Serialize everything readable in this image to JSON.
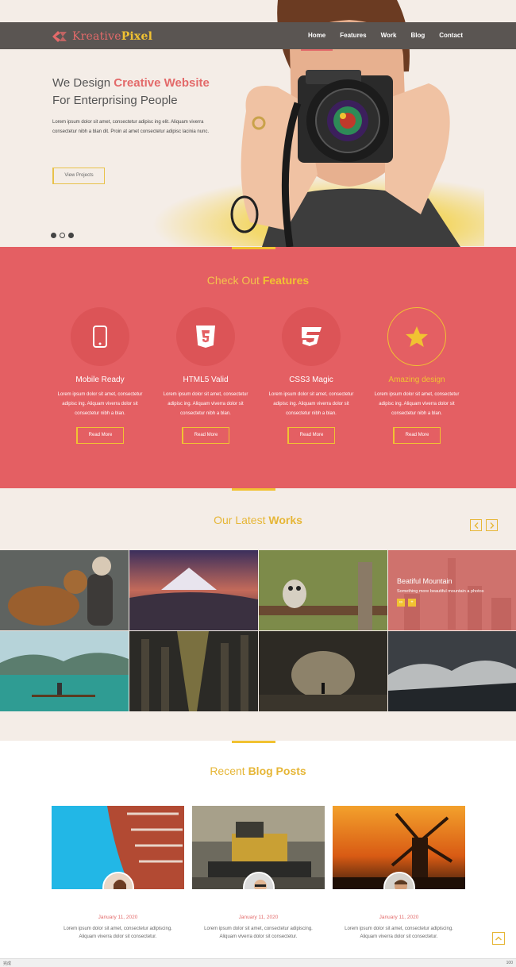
{
  "brand": {
    "name_part1": "Kreative",
    "name_part2": "Pixel"
  },
  "nav": {
    "items": [
      "Home",
      "Features",
      "Work",
      "Blog",
      "Contact"
    ],
    "active": "Home"
  },
  "hero": {
    "title_line1_prefix": "We Design ",
    "title_line1_highlight": "Creative Website",
    "title_line2": "For Enterprising People",
    "text": "Lorem ipsum dolor sit amet, consectetur adipisc ing elit. Aliquam viverra consectetur nibh a blan dit. Proin at amet consectetur adipisc lacinia nunc.",
    "button": "View Projects",
    "slides_total": 3,
    "slide_active": 1
  },
  "features": {
    "title_prefix": "Check Out ",
    "title_bold": "Features",
    "items": [
      {
        "icon": "mobile-icon",
        "title": "Mobile Ready",
        "text": "Lorem ipsum dolor sit amet, consectetur adipisc ing. Aliquam viverra dolor sit consectetur nibh a blan.",
        "button": "Read More"
      },
      {
        "icon": "html5-icon",
        "title": "HTML5 Valid",
        "text": "Lorem ipsum dolor sit amet, consectetur adipisc ing. Aliquam viverra dolor sit consectetur nibh a blan.",
        "button": "Read More"
      },
      {
        "icon": "css3-icon",
        "title": "CSS3 Magic",
        "text": "Lorem ipsum dolor sit amet, consectetur adipisc ing. Aliquam viverra dolor sit consectetur nibh a blan.",
        "button": "Read More"
      },
      {
        "icon": "star-icon",
        "title": "Amazing design",
        "text": "Lorem ipsum dolor sit amet, consectetur adipisc ing. Aliquam viverra dolor sit consectetur nibh a blan.",
        "button": "Read More"
      }
    ]
  },
  "works": {
    "title_prefix": "Our Latest ",
    "title_bold": "Works",
    "overlay_title": "Beatiful Mountain",
    "overlay_sub": "Something more beautiful mountain a photos"
  },
  "blog": {
    "title_prefix": "Recent  ",
    "title_bold": "Blog Posts",
    "posts": [
      {
        "date": "January 11, 2020",
        "text": "Lorem ipsum dolor sit amet, consectetur adipiscing. Aliquam viverra dolor sit consectetur."
      },
      {
        "date": "January 11, 2020",
        "text": "Lorem ipsum dolor sit amet, consectetur adipiscing. Aliquam viverra dolor sit consectetur."
      },
      {
        "date": "January 11, 2020",
        "text": "Lorem ipsum dolor sit amet, consectetur adipiscing. Aliquam viverra dolor sit consectetur."
      }
    ]
  },
  "statusbar": {
    "left": "完成",
    "right": "100"
  },
  "colors": {
    "coral": "#e45f63",
    "gold": "#f1c232",
    "cream": "#f4ede7",
    "nav": "#5a5552"
  }
}
